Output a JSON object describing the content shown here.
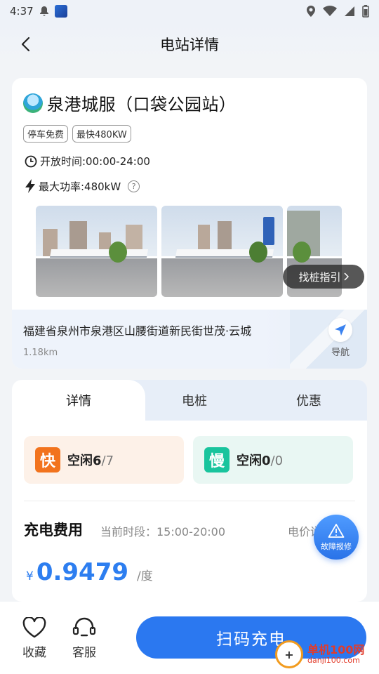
{
  "status_bar": {
    "time": "4:37"
  },
  "header": {
    "title": "电站详情"
  },
  "station": {
    "name": "泉港城服（口袋公园站）",
    "tags": [
      "停车免费",
      "最快480KW"
    ],
    "hours": "开放时间:00:00-24:00",
    "max_power": "最大功率:480kW",
    "help": "?",
    "find_label": "找桩指引",
    "address": "福建省泉州市泉港区山腰街道新民街世茂·云城",
    "distance": "1.18km",
    "nav_label": "导航"
  },
  "tabs": [
    {
      "label": "详情",
      "active": true
    },
    {
      "label": "电桩",
      "active": false
    },
    {
      "label": "优惠",
      "active": false
    }
  ],
  "piles": {
    "fast": {
      "icon_label": "快",
      "text": "空闲6",
      "total": "/7"
    },
    "slow": {
      "icon_label": "慢",
      "text": "空闲0",
      "total": "/0"
    }
  },
  "fee": {
    "title": "充电费用",
    "period": "当前时段：15:00-20:00",
    "price_label": "电价说",
    "currency": "¥",
    "price": "0.9479",
    "unit": "/度"
  },
  "report": {
    "label": "故障报修"
  },
  "bottom_bar": {
    "favorite_label": "收藏",
    "service_label": "客服",
    "scan_label": "扫码充电"
  },
  "watermark": {
    "main": "单机100网",
    "sub": "danji100.com"
  },
  "colors": {
    "primary": "#2b78f0",
    "fast": "#f2731d",
    "slow": "#19c49d"
  }
}
